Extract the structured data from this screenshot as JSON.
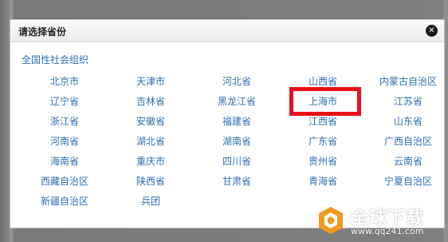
{
  "dialog": {
    "title": "请选择省份",
    "close_icon": "close-icon",
    "national_link": "全国性社会组织"
  },
  "provinces": [
    "北京市",
    "天津市",
    "河北省",
    "山西省",
    "内蒙古自治区",
    "辽宁省",
    "吉林省",
    "黑龙江省",
    "上海市",
    "江苏省",
    "浙江省",
    "安徽省",
    "福建省",
    "江西省",
    "山东省",
    "河南省",
    "湖北省",
    "湖南省",
    "广东省",
    "广西自治区",
    "海南省",
    "重庆市",
    "四川省",
    "贵州省",
    "云南省",
    "西藏自治区",
    "陕西省",
    "甘肃省",
    "青海省",
    "宁夏自治区",
    "新疆自治区",
    "兵团"
  ],
  "highlighted_province": "上海市",
  "colors": {
    "link": "#2f6fb0",
    "highlight": "#e8101a",
    "watermark_orange": "#f39a1e"
  },
  "watermark": {
    "brand": "全球下载",
    "url": "www.qq241.com"
  }
}
